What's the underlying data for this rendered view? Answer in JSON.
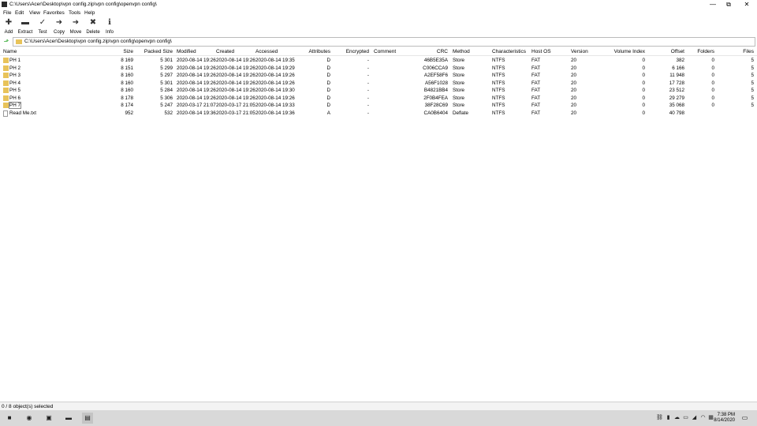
{
  "window": {
    "title": "C:\\Users\\Acer\\Desktop\\vpn config.zip\\vpn config\\openvpn config\\",
    "minimize_glyph": "—",
    "maximize_glyph": "⧉",
    "close_glyph": "✕"
  },
  "menu": [
    "File",
    "Edit",
    "View",
    "Favorites",
    "Tools",
    "Help"
  ],
  "toolbar": [
    {
      "label": "Add",
      "icon": "add-icon",
      "glyph": "✚"
    },
    {
      "label": "Extract",
      "icon": "extract-icon",
      "glyph": "▬"
    },
    {
      "label": "Test",
      "icon": "test-icon",
      "glyph": "✓"
    },
    {
      "label": "Copy",
      "icon": "copy-icon",
      "glyph": "➜"
    },
    {
      "label": "Move",
      "icon": "move-icon",
      "glyph": "➜"
    },
    {
      "label": "Delete",
      "icon": "delete-icon",
      "glyph": "✖"
    },
    {
      "label": "Info",
      "icon": "info-icon",
      "glyph": "ℹ"
    }
  ],
  "address": {
    "path": "C:\\Users\\Acer\\Desktop\\vpn config.zip\\vpn config\\openvpn config\\",
    "up_glyph": "⬏"
  },
  "columns": [
    "Name",
    "Size",
    "Packed Size",
    "Modified",
    "Created",
    "Accessed",
    "Attributes",
    "Encrypted",
    "Comment",
    "CRC",
    "Method",
    "Characteristics",
    "Host OS",
    "Version",
    "Volume Index",
    "Offset",
    "Folders",
    "Files"
  ],
  "rows": [
    {
      "kind": "folder",
      "name": "PH 1",
      "size": "8 169",
      "packed": "5 301",
      "modified": "2020-08-14 19:26",
      "created": "2020-08-14 19:26",
      "accessed": "2020-08-14 19:35",
      "attributes": "D",
      "encrypted": "-",
      "comment": "",
      "crc": "46B5E35A",
      "method": "Store",
      "characteristics": "NTFS",
      "host_os": "FAT",
      "version": "20",
      "volume_index": "0",
      "offset": "382",
      "folders": "0",
      "files": "5"
    },
    {
      "kind": "folder",
      "name": "PH 2",
      "size": "8 151",
      "packed": "5 299",
      "modified": "2020-08-14 19:26",
      "created": "2020-08-14 19:26",
      "accessed": "2020-08-14 19:29",
      "attributes": "D",
      "encrypted": "-",
      "comment": "",
      "crc": "C006CCA9",
      "method": "Store",
      "characteristics": "NTFS",
      "host_os": "FAT",
      "version": "20",
      "volume_index": "0",
      "offset": "6 166",
      "folders": "0",
      "files": "5"
    },
    {
      "kind": "folder",
      "name": "PH 3",
      "size": "8 160",
      "packed": "5 297",
      "modified": "2020-08-14 19:26",
      "created": "2020-08-14 19:26",
      "accessed": "2020-08-14 19:26",
      "attributes": "D",
      "encrypted": "-",
      "comment": "",
      "crc": "A2EF58F6",
      "method": "Store",
      "characteristics": "NTFS",
      "host_os": "FAT",
      "version": "20",
      "volume_index": "0",
      "offset": "11 948",
      "folders": "0",
      "files": "5"
    },
    {
      "kind": "folder",
      "name": "PH 4",
      "size": "8 160",
      "packed": "5 301",
      "modified": "2020-08-14 19:26",
      "created": "2020-08-14 19:26",
      "accessed": "2020-08-14 19:26",
      "attributes": "D",
      "encrypted": "-",
      "comment": "",
      "crc": "A56F1028",
      "method": "Store",
      "characteristics": "NTFS",
      "host_os": "FAT",
      "version": "20",
      "volume_index": "0",
      "offset": "17 728",
      "folders": "0",
      "files": "5"
    },
    {
      "kind": "folder",
      "name": "PH 5",
      "size": "8 160",
      "packed": "5 284",
      "modified": "2020-08-14 19:26",
      "created": "2020-08-14 19:26",
      "accessed": "2020-08-14 19:30",
      "attributes": "D",
      "encrypted": "-",
      "comment": "",
      "crc": "B4821BB4",
      "method": "Store",
      "characteristics": "NTFS",
      "host_os": "FAT",
      "version": "20",
      "volume_index": "0",
      "offset": "23 512",
      "folders": "0",
      "files": "5"
    },
    {
      "kind": "folder",
      "name": "PH 6",
      "size": "8 178",
      "packed": "5 306",
      "modified": "2020-08-14 19:26",
      "created": "2020-08-14 19:26",
      "accessed": "2020-08-14 19:26",
      "attributes": "D",
      "encrypted": "-",
      "comment": "",
      "crc": "2F0B4FEA",
      "method": "Store",
      "characteristics": "NTFS",
      "host_os": "FAT",
      "version": "20",
      "volume_index": "0",
      "offset": "29 279",
      "folders": "0",
      "files": "5"
    },
    {
      "kind": "folder",
      "name": "PH 7",
      "size": "8 174",
      "packed": "5 247",
      "modified": "2020-03-17 21:07",
      "created": "2020-03-17 21:05",
      "accessed": "2020-08-14 19:33",
      "attributes": "D",
      "encrypted": "-",
      "comment": "",
      "crc": "38F28C69",
      "method": "Store",
      "characteristics": "NTFS",
      "host_os": "FAT",
      "version": "20",
      "volume_index": "0",
      "offset": "35 068",
      "folders": "0",
      "files": "5",
      "focused": true
    },
    {
      "kind": "file",
      "name": "Read Me.txt",
      "size": "952",
      "packed": "532",
      "modified": "2020-08-14 19:36",
      "created": "2020-03-17 21:05",
      "accessed": "2020-08-14 19:36",
      "attributes": "A",
      "encrypted": "-",
      "comment": "",
      "crc": "CA0B6404",
      "method": "Deflate",
      "characteristics": "NTFS",
      "host_os": "FAT",
      "version": "20",
      "volume_index": "0",
      "offset": "40 798",
      "folders": "",
      "files": ""
    }
  ],
  "status": {
    "text": "0 / 8 object(s) selected"
  },
  "taskbar": {
    "items": [
      {
        "name": "start-icon",
        "glyph": "■"
      },
      {
        "name": "chrome-icon",
        "glyph": "◉"
      },
      {
        "name": "app-icon-2",
        "glyph": "▣"
      },
      {
        "name": "app-icon-3",
        "glyph": "▬"
      },
      {
        "name": "7zip-taskbar-icon",
        "glyph": "▤"
      }
    ],
    "tray": [
      {
        "name": "network-icon",
        "glyph": "⛓"
      },
      {
        "name": "usb-icon",
        "glyph": "▮"
      },
      {
        "name": "onedrive-icon",
        "glyph": "☁"
      },
      {
        "name": "battery-icon",
        "glyph": "▭"
      },
      {
        "name": "volume-icon",
        "glyph": "◢"
      },
      {
        "name": "wifi-icon",
        "glyph": "◠"
      },
      {
        "name": "display-icon",
        "glyph": "▦"
      }
    ],
    "time": "7:38 PM",
    "date": "8/14/2020",
    "notification_glyph": "▭"
  }
}
